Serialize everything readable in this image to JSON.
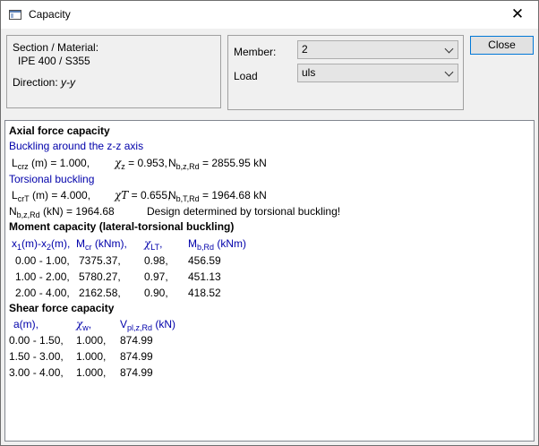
{
  "window": {
    "title": "Capacity",
    "close_glyph": "✕"
  },
  "info_panel": {
    "section_label": "Section / Material:",
    "section_value": "IPE 400 / S355",
    "direction_label": "Direction:",
    "direction_value": "y-y"
  },
  "member_panel": {
    "member_label": "Member:",
    "member_value": "2",
    "load_label": "Load",
    "load_value": "uls"
  },
  "buttons": {
    "close": "Close"
  },
  "report": {
    "axial": {
      "heading": "Axial force capacity",
      "buckling_zz": "Buckling around the z-z axis",
      "l_main": "L",
      "l_sub": "crz",
      "l_value": " (m) = 1.000,",
      "chi_main": "χ",
      "chi_sub": "z",
      "chi_value": " = 0.953,",
      "n_main": "N",
      "n_sub": "b,z,Rd",
      "n_value": " = 2855.95 kN",
      "torsional": "Torsional buckling",
      "lt_main": "L",
      "lt_sub": "crT",
      "lt_value": " (m) = 4.000,",
      "chit_main": "χT",
      "chit_value": " = 0.655,",
      "nt_main": "N",
      "nt_sub": "b,T,Rd",
      "nt_value": " = 1964.68 kN",
      "nd_main": "N",
      "nd_sub": "b,z,Rd",
      "nd_value": " (kN) = 1964.68",
      "design_note": "Design determined by torsional buckling!"
    },
    "moment": {
      "heading": "Moment capacity  (lateral-torsional buckling)",
      "col1_a": "x",
      "col1_a_sub": "1",
      "col1_b": "(m)-x",
      "col1_b_sub": "2",
      "col1_c": "(m),",
      "col2_main": "M",
      "col2_sub": "cr",
      "col2_rest": " (kNm),",
      "col3_main": "χ",
      "col3_sub": "LT",
      "col3_rest": ",",
      "col4_main": "M",
      "col4_sub": "b,Rd",
      "col4_rest": " (kNm)",
      "rows": [
        {
          "range": "0.00 - 1.00,",
          "mcr": "7375.37,",
          "chi": "0.98,",
          "mb": "456.59"
        },
        {
          "range": "1.00 - 2.00,",
          "mcr": "5780.27,",
          "chi": "0.97,",
          "mb": "451.13"
        },
        {
          "range": "2.00 - 4.00,",
          "mcr": "2162.58,",
          "chi": "0.90,",
          "mb": "418.52"
        }
      ]
    },
    "shear": {
      "heading": "Shear force capacity",
      "col1": "a(m),",
      "col2_main": "χ",
      "col2_sub": "w",
      "col2_rest": ",",
      "col3_main": "V",
      "col3_sub": "pl,z,Rd",
      "col3_rest": " (kN)",
      "rows": [
        {
          "range": "0.00 - 1.50,",
          "chi": "1.000,",
          "v": "874.99"
        },
        {
          "range": "1.50 - 3.00,",
          "chi": "1.000,",
          "v": "874.99"
        },
        {
          "range": "3.00 - 4.00,",
          "chi": "1.000,",
          "v": "874.99"
        }
      ]
    }
  }
}
